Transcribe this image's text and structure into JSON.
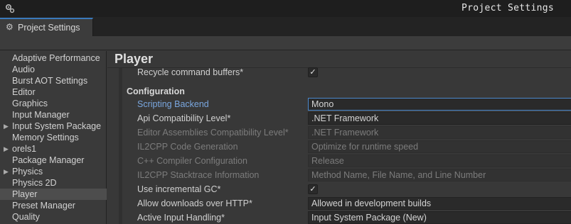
{
  "window": {
    "title": "Project Settings",
    "app_icon": "gear-cluster-icon"
  },
  "tab": {
    "label": "Project Settings",
    "icon": "gear-icon"
  },
  "sidebar": {
    "items": [
      {
        "label": "Adaptive Performance",
        "expandable": false,
        "selected": false
      },
      {
        "label": "Audio",
        "expandable": false,
        "selected": false
      },
      {
        "label": "Burst AOT Settings",
        "expandable": false,
        "selected": false
      },
      {
        "label": "Editor",
        "expandable": false,
        "selected": false
      },
      {
        "label": "Graphics",
        "expandable": false,
        "selected": false
      },
      {
        "label": "Input Manager",
        "expandable": false,
        "selected": false
      },
      {
        "label": "Input System Package",
        "expandable": true,
        "selected": false
      },
      {
        "label": "Memory Settings",
        "expandable": false,
        "selected": false
      },
      {
        "label": "orels1",
        "expandable": true,
        "selected": false
      },
      {
        "label": "Package Manager",
        "expandable": false,
        "selected": false
      },
      {
        "label": "Physics",
        "expandable": true,
        "selected": false
      },
      {
        "label": "Physics 2D",
        "expandable": false,
        "selected": false
      },
      {
        "label": "Player",
        "expandable": false,
        "selected": true
      },
      {
        "label": "Preset Manager",
        "expandable": false,
        "selected": false
      },
      {
        "label": "Quality",
        "expandable": false,
        "selected": false
      }
    ]
  },
  "main": {
    "title": "Player",
    "recycle": {
      "label": "Recycle command buffers*",
      "checked": true
    },
    "configuration_header": "Configuration",
    "rows": {
      "scripting_backend": {
        "label": "Scripting Backend",
        "value": "Mono"
      },
      "api_compat": {
        "label": "Api Compatibility Level*",
        "value": ".NET Framework"
      },
      "editor_assemblies": {
        "label": "Editor Assemblies Compatibility Level*",
        "value": ".NET Framework"
      },
      "il2cpp_codegen": {
        "label": "IL2CPP Code Generation",
        "value": "Optimize for runtime speed"
      },
      "cpp_compiler": {
        "label": "C++ Compiler Configuration",
        "value": "Release"
      },
      "il2cpp_stacktrace": {
        "label": "IL2CPP Stacktrace Information",
        "value": "Method Name, File Name, and Line Number"
      },
      "incremental_gc": {
        "label": "Use incremental GC*",
        "checked": true
      },
      "allow_http": {
        "label": "Allow downloads over HTTP*",
        "value": "Allowed in development builds"
      },
      "input_handling": {
        "label": "Active Input Handling*",
        "value": "Input System Package (New)"
      }
    }
  },
  "glyphs": {
    "check": "✓",
    "expand_arrow": "▶",
    "gear": "⚙"
  },
  "colors": {
    "accent": "#3a79bb",
    "highlight_label": "#7aa7e0",
    "background": "#383838"
  }
}
